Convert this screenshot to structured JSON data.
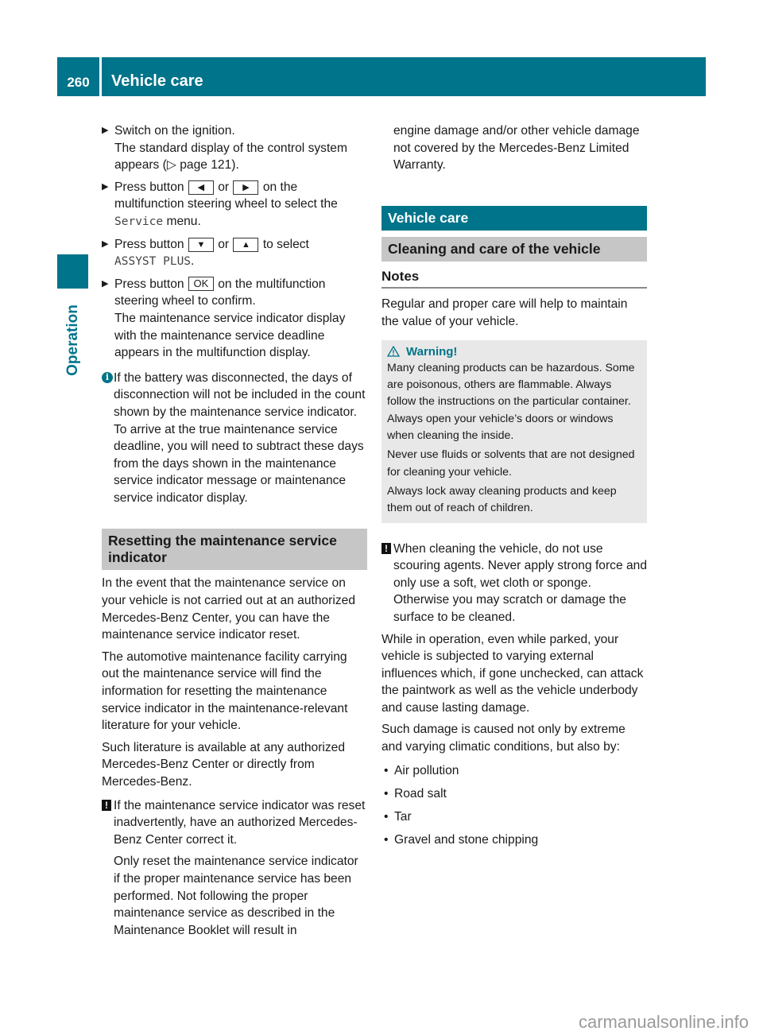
{
  "header": {
    "page_number": "260",
    "title": "Vehicle care"
  },
  "sidebar": {
    "section_label": "Operation"
  },
  "left_column": {
    "steps": [
      {
        "text": "Switch on the ignition.",
        "detail_pre": "The standard display of the control system appears (",
        "page_ref_icon": "▷",
        "page_ref": "page 121",
        "detail_post": ")."
      },
      {
        "pre": "Press button",
        "key1": "◀",
        "or": "or",
        "key2": "▶",
        "post": "on the multifunction steering wheel to select the",
        "mono": "Service",
        "end": "menu."
      },
      {
        "pre": "Press button",
        "key1": "▼",
        "or": "or",
        "key2": "▲",
        "post": "to select",
        "mono": "ASSYST PLUS",
        "end": "."
      },
      {
        "pre": "Press button",
        "key1": "OK",
        "post": "on the multifunction steering wheel to confirm.",
        "detail": "The maintenance service indicator display with the maintenance service deadline appears in the multifunction display."
      }
    ],
    "info_note": "If the battery was disconnected, the days of disconnection will not be included in the count shown by the maintenance service indicator. To arrive at the true maintenance service deadline, you will need to subtract these days from the days shown in the maintenance service indicator message or maintenance service indicator display.",
    "section_heading": "Resetting the maintenance service indicator",
    "paragraphs": [
      "In the event that the maintenance service on your vehicle is not carried out at an authorized Mercedes-Benz Center, you can have the maintenance service indicator reset.",
      "The automotive maintenance facility carrying out the maintenance service will find the information for resetting the maintenance service indicator in the maintenance-relevant literature for your vehicle.",
      "Such literature is available at any authorized Mercedes-Benz Center or directly from Mercedes-Benz."
    ],
    "caution_note": {
      "icon": "!",
      "text": "If the maintenance service indicator was reset inadvertently, have an authorized Mercedes-Benz Center correct it.",
      "text2": "Only reset the maintenance service indicator if the proper maintenance service has been performed. Not following the proper maintenance service as described in the Maintenance Booklet will result in"
    }
  },
  "right_column": {
    "continuation": "engine damage and/or other vehicle damage not covered by the Mercedes-Benz Limited Warranty.",
    "chapter_heading": "Vehicle care",
    "section_heading": "Cleaning and care of the vehicle",
    "subheading": "Notes",
    "intro": "Regular and proper care will help to maintain the value of your vehicle.",
    "warning": {
      "title": "Warning!",
      "paragraphs": [
        "Many cleaning products can be hazardous. Some are poisonous, others are flammable. Always follow the instructions on the particular container. Always open your vehicle’s doors or windows when cleaning the inside.",
        "Never use fluids or solvents that are not designed for cleaning your vehicle.",
        "Always lock away cleaning products and keep them out of reach of children."
      ]
    },
    "caution_note": {
      "icon": "!",
      "text": "When cleaning the vehicle, do not use scouring agents. Never apply strong force and only use a soft, wet cloth or sponge. Otherwise you may scratch or damage the surface to be cleaned."
    },
    "paragraphs": [
      "While in operation, even while parked, your vehicle is subjected to varying external influences which, if gone unchecked, can attack the paintwork as well as the vehicle underbody and cause lasting damage.",
      "Such damage is caused not only by extreme and varying climatic conditions, but also by:"
    ],
    "bullets": [
      "Air pollution",
      "Road salt",
      "Tar",
      "Gravel and stone chipping"
    ]
  },
  "watermark": "carmanualsonline.info",
  "colors": {
    "accent": "#00748a",
    "section_grey": "#c6c6c6",
    "warning_bg": "#e8e8e8"
  }
}
